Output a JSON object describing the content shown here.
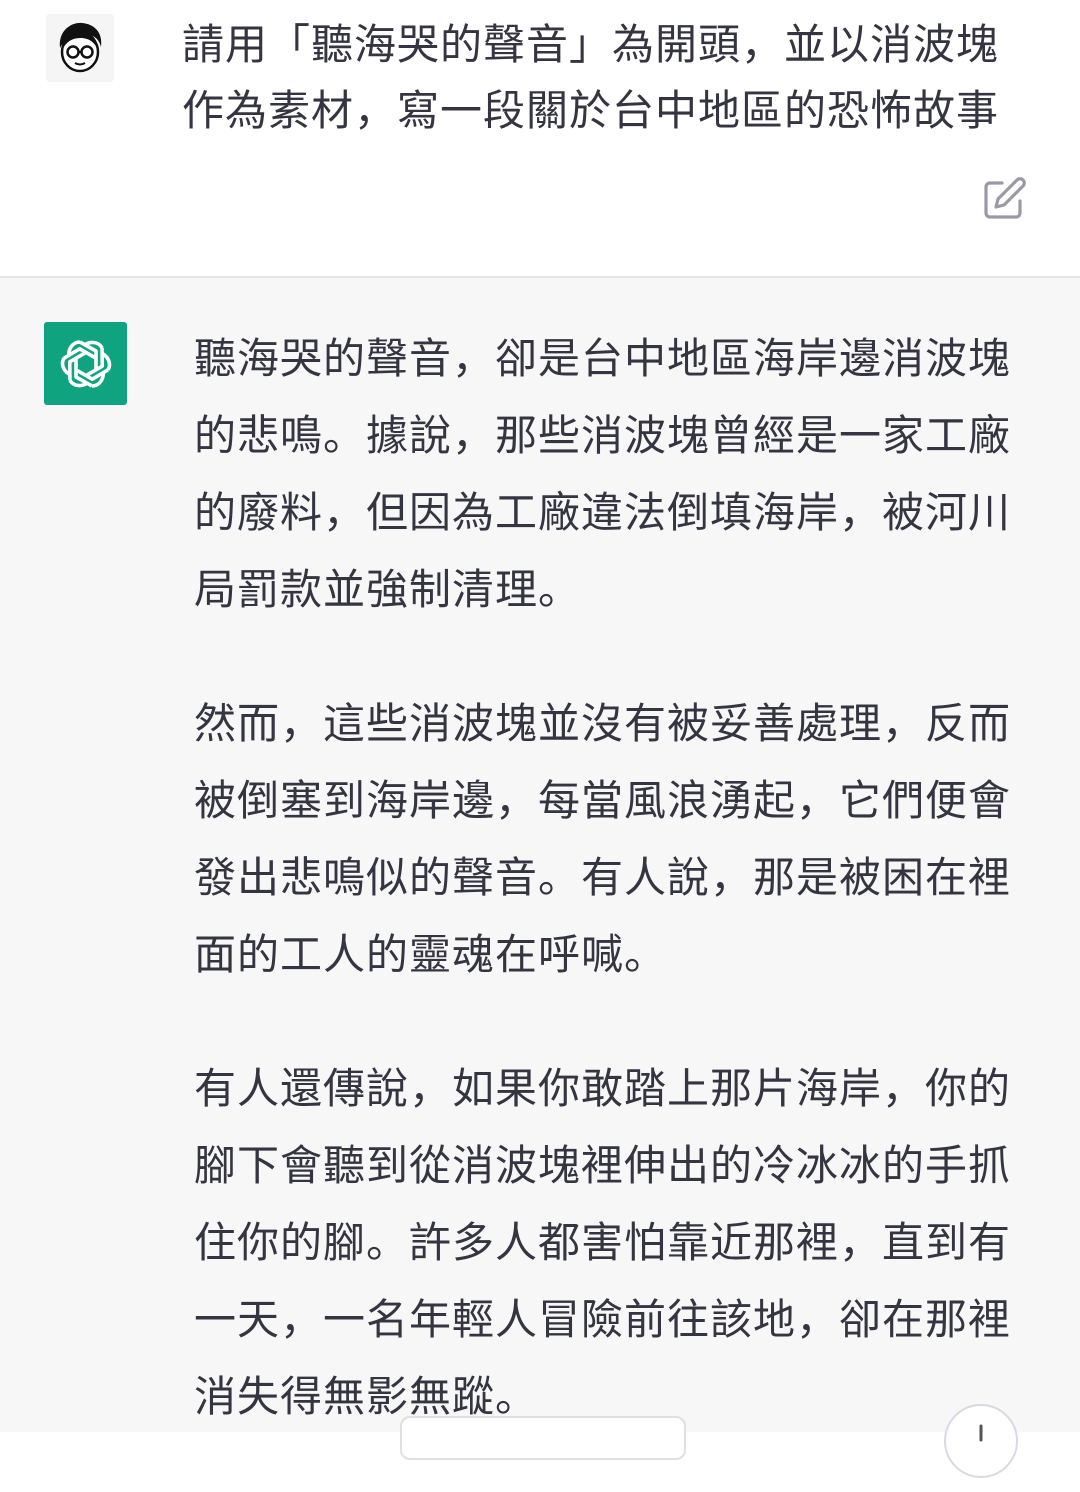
{
  "user_message": {
    "lines": [
      "請用「聽海哭的聲音」為開頭，並以消波塊",
      "作為素材，寫一段關於台中地區的恐怖故事"
    ]
  },
  "assistant_message": {
    "paragraphs": [
      [
        "聽海哭的聲音，卻是台中地區海岸邊消波塊",
        "的悲鳴。據說，那些消波塊曾經是一家工廠",
        "的廢料，但因為工廠違法倒填海岸，被河川",
        "局罰款並強制清理。"
      ],
      [
        "然而，這些消波塊並沒有被妥善處理，反而",
        "被倒塞到海岸邊，每當風浪湧起，它們便會",
        "發出悲鳴似的聲音。有人說，那是被困在裡",
        "面的工人的靈魂在呼喊。"
      ],
      [
        "有人還傳說，如果你敢踏上那片海岸，你的",
        "腳下會聽到從消波塊裡伸出的冷冰冰的手抓",
        "住你的腳。許多人都害怕靠近那裡，直到有",
        "一天，一名年輕人冒險前往該地，卻在那裡",
        "消失得無影無蹤。"
      ]
    ]
  },
  "colors": {
    "assistant_bg": "#f7f7f8",
    "logo_green": "#10a37f",
    "text": "#343541"
  },
  "icons": {
    "user_avatar": "user-avatar-icon",
    "assistant_logo": "openai-logo-icon",
    "edit": "edit-icon",
    "scroll": "scroll-down-icon"
  }
}
